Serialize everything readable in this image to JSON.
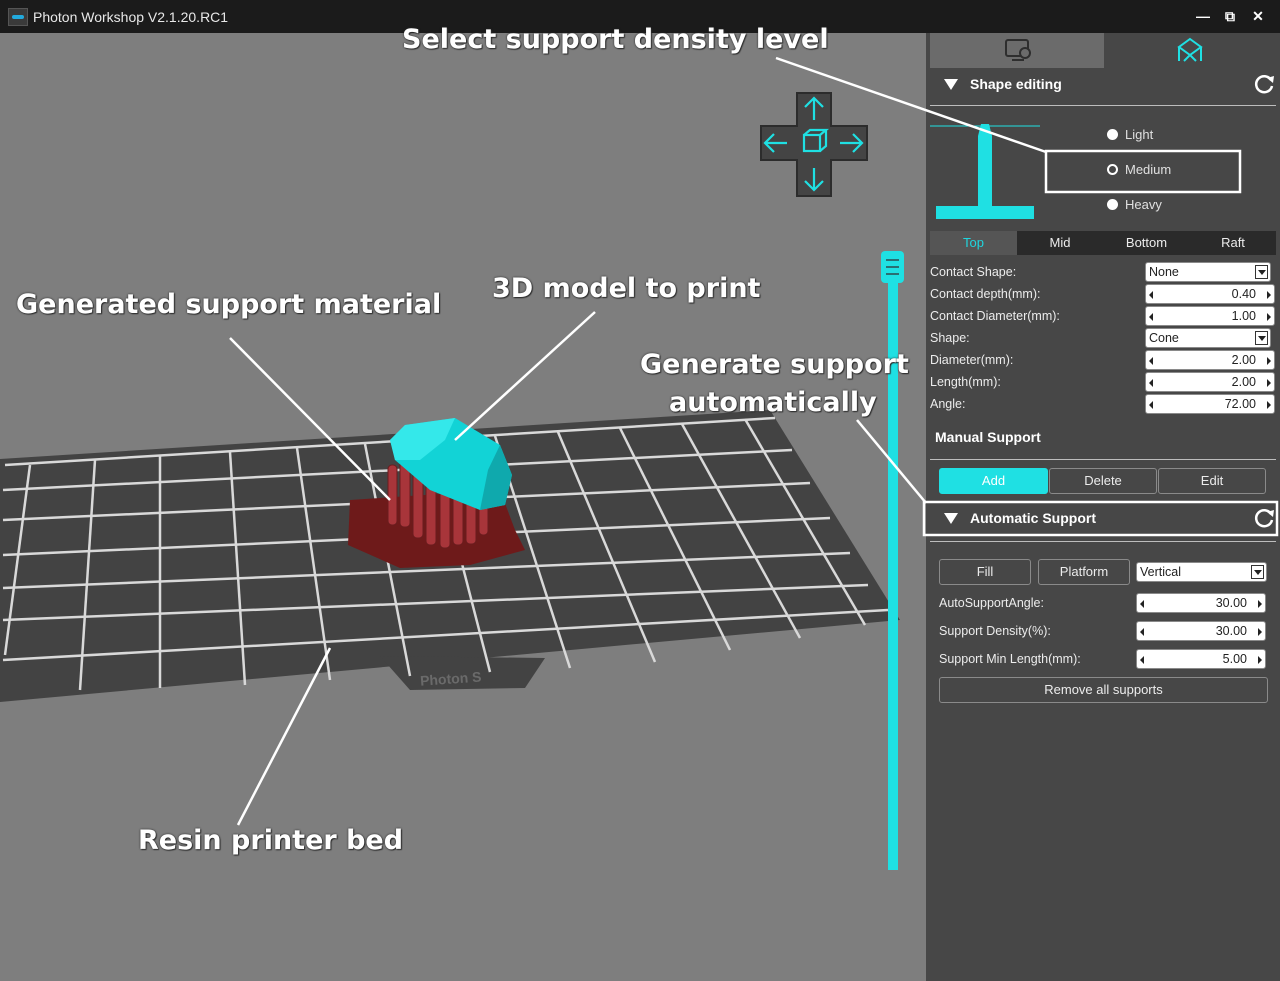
{
  "window": {
    "title": "Photon Workshop V2.1.20.RC1",
    "minimize": "—",
    "maximize": "⧉",
    "close": "✕"
  },
  "viewport": {
    "plate_label": "Photon S",
    "accent": "#1fe0e3",
    "model_color": "#12d3d6",
    "support_color": "#8b2a2a"
  },
  "panel": {
    "shape_editing": {
      "title": "Shape editing",
      "density_options": [
        {
          "label": "Light",
          "selected": false
        },
        {
          "label": "Medium",
          "selected": true
        },
        {
          "label": "Heavy",
          "selected": false
        }
      ]
    },
    "subtabs": [
      "Top",
      "Mid",
      "Bottom",
      "Raft"
    ],
    "active_subtab": "Top",
    "params": [
      {
        "label": "Contact Shape:",
        "value": "None",
        "type": "dropdown"
      },
      {
        "label": "Contact depth(mm):",
        "value": "0.40",
        "type": "spin"
      },
      {
        "label": "Contact Diameter(mm):",
        "value": "1.00",
        "type": "spin"
      },
      {
        "label": "Shape:",
        "value": "Cone",
        "type": "dropdown"
      },
      {
        "label": "Diameter(mm):",
        "value": "2.00",
        "type": "spin"
      },
      {
        "label": "Length(mm):",
        "value": "2.00",
        "type": "spin"
      },
      {
        "label": "Angle:",
        "value": "72.00",
        "type": "spin"
      }
    ],
    "manual_support": {
      "title": "Manual Support",
      "add": "Add",
      "delete": "Delete",
      "edit": "Edit"
    },
    "automatic_support": {
      "title": "Automatic Support",
      "fill": "Fill",
      "platform": "Platform",
      "direction": "Vertical",
      "params": [
        {
          "label": "AutoSupportAngle:",
          "value": "30.00"
        },
        {
          "label": "Support Density(%):",
          "value": "30.00"
        },
        {
          "label": "Support Min Length(mm):",
          "value": "5.00"
        }
      ],
      "remove_all": "Remove all supports"
    }
  },
  "annotations": {
    "density": "Select support density level",
    "support_material": "Generated support material",
    "model": "3D model to print",
    "auto_support_1": "Generate support",
    "auto_support_2": "automatically",
    "bed": "Resin printer bed"
  }
}
